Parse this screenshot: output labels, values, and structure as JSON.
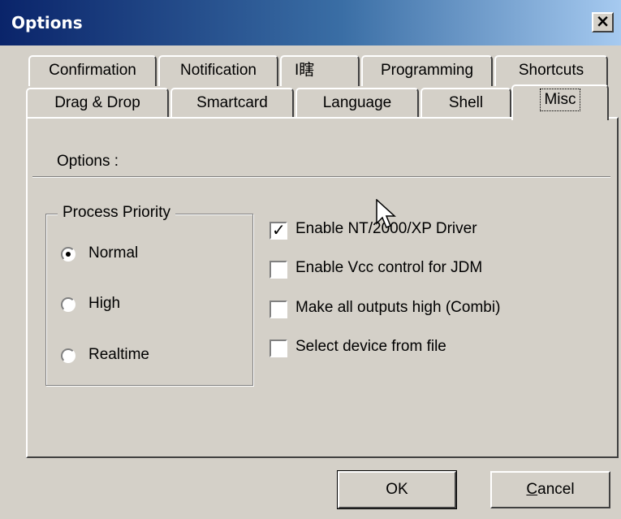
{
  "window": {
    "title": "Options",
    "close_glyph": "×"
  },
  "tabs_row1": [
    {
      "label": "Confirmation"
    },
    {
      "label": "Notification"
    },
    {
      "label": "I瞎"
    },
    {
      "label": "Programming"
    },
    {
      "label": "Shortcuts"
    }
  ],
  "tabs_row2": [
    {
      "label": "Drag & Drop"
    },
    {
      "label": "Smartcard"
    },
    {
      "label": "Language"
    },
    {
      "label": "Shell"
    },
    {
      "label": "Misc",
      "active": true
    }
  ],
  "panel": {
    "options_label": "Options :",
    "group": {
      "title": "Process Priority",
      "radios": [
        {
          "label": "Normal",
          "checked": true
        },
        {
          "label": "High",
          "checked": false
        },
        {
          "label": "Realtime",
          "checked": false
        }
      ]
    },
    "checkboxes": [
      {
        "label": "Enable NT/2000/XP Driver",
        "checked": true
      },
      {
        "label": "Enable Vcc control for JDM",
        "checked": false
      },
      {
        "label": "Make all outputs high (Combi)",
        "checked": false
      },
      {
        "label": "Select device from file",
        "checked": false
      }
    ]
  },
  "buttons": {
    "ok": "OK",
    "cancel_first": "C",
    "cancel_rest": "ancel"
  }
}
